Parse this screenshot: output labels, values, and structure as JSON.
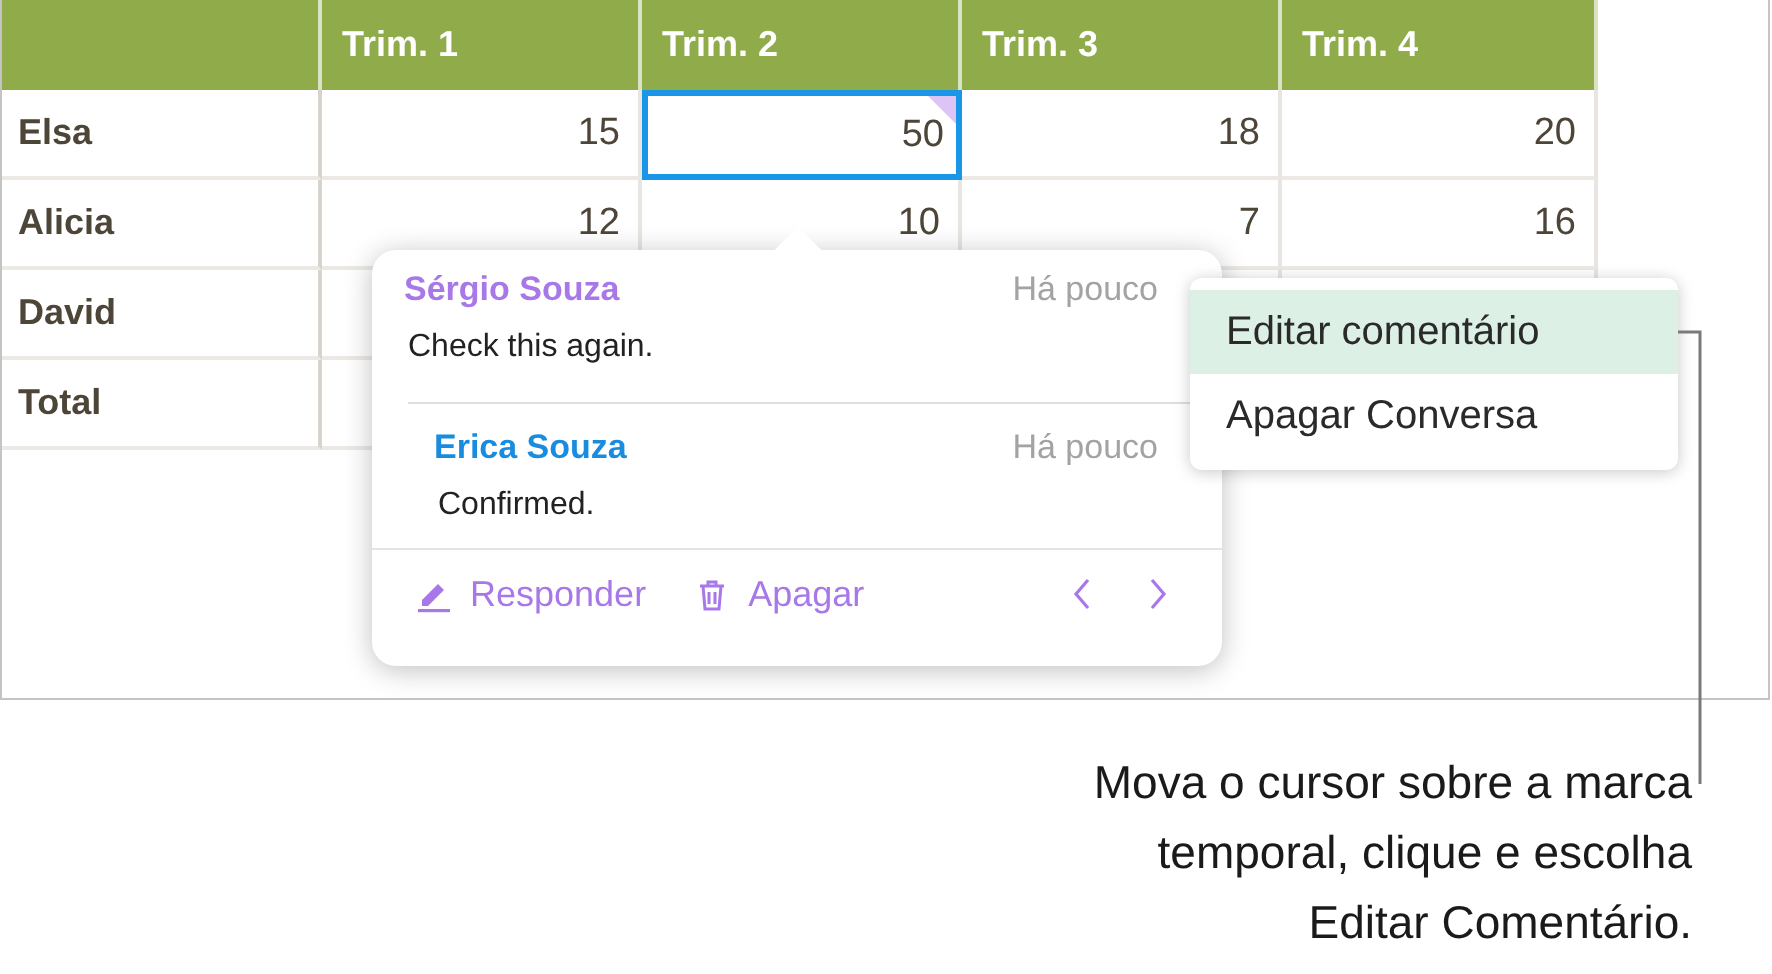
{
  "table": {
    "columns": [
      "Trim. 1",
      "Trim. 2",
      "Trim. 3",
      "Trim. 4"
    ],
    "rows": [
      {
        "label": "Elsa",
        "cells": [
          {
            "value": "15",
            "selected": false,
            "comment": false
          },
          {
            "value": "50",
            "selected": true,
            "comment": true
          },
          {
            "value": "18",
            "selected": false,
            "comment": false
          },
          {
            "value": "20",
            "selected": false,
            "comment": false
          }
        ]
      },
      {
        "label": "Alicia",
        "cells": [
          {
            "value": "12",
            "selected": false,
            "comment": false
          },
          {
            "value": "10",
            "selected": false,
            "comment": false
          },
          {
            "value": "7",
            "selected": false,
            "comment": false
          },
          {
            "value": "16",
            "selected": false,
            "comment": false
          }
        ]
      },
      {
        "label": "David",
        "cells": [
          null,
          null,
          null,
          null
        ]
      },
      {
        "label": "Total",
        "cells": [
          null,
          null,
          null,
          null
        ]
      }
    ]
  },
  "comments": [
    {
      "author": "Sérgio Souza",
      "color": "#a878e8",
      "time": "Há pouco",
      "text": "Check this again.",
      "reply": false
    },
    {
      "author": "Erica Souza",
      "color": "#1a8ce0",
      "time": "Há pouco",
      "text": "Confirmed.",
      "reply": true
    }
  ],
  "comment_actions": [
    {
      "kind": "reply",
      "label": "Responder"
    },
    {
      "kind": "delete",
      "label": "Apagar"
    }
  ],
  "menu": [
    {
      "label": "Editar comentário",
      "selected": true
    },
    {
      "label": "Apagar Conversa",
      "selected": false
    }
  ],
  "caption": [
    "Mova o cursor sobre a marca",
    "temporal, clique e escolha",
    "Editar Comentário."
  ]
}
